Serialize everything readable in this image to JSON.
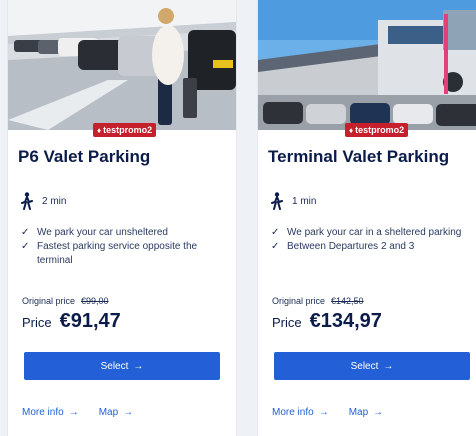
{
  "colors": {
    "accent": "#2360d8",
    "promo": "#c5202b",
    "title": "#0b1c4a"
  },
  "cards": [
    {
      "promo": "testpromo2",
      "title": "P6 Valet Parking",
      "duration": "2 min",
      "features": [
        "We park your car unsheltered",
        "Fastest parking service opposite the terminal"
      ],
      "original_price_label": "Original price",
      "original_price": "€99,00",
      "price_label": "Price",
      "price": "€91,47",
      "select_label": "Select",
      "more_info_label": "More info",
      "map_label": "Map"
    },
    {
      "promo": "testpromo2",
      "title": "Terminal Valet Parking",
      "duration": "1 min",
      "features": [
        "We park your car in a sheltered parking",
        "Between Departures 2 and 3"
      ],
      "original_price_label": "Original price",
      "original_price": "€142,50",
      "price_label": "Price",
      "price": "€134,97",
      "select_label": "Select",
      "more_info_label": "More info",
      "map_label": "Map"
    }
  ],
  "icons": {
    "walk": "walking-person-icon",
    "check": "checkmark-icon",
    "arrow": "arrow-right-icon",
    "tag": "tag-icon"
  }
}
